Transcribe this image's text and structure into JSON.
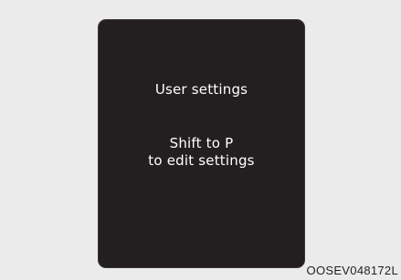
{
  "colors": {
    "background": "#ebebeb",
    "screen": "#231f20",
    "screen_text": "#ffffff",
    "caption_text": "#231f20"
  },
  "display": {
    "title": "User settings",
    "message_line1": "Shift to P",
    "message_line2": "to edit settings"
  },
  "figure": {
    "code": "OOSEV048172L"
  }
}
